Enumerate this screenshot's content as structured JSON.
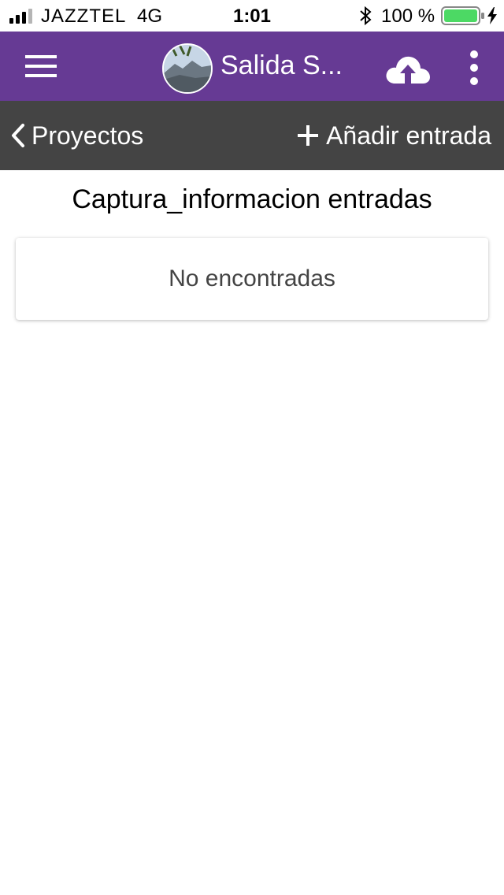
{
  "status_bar": {
    "carrier": "JAZZTEL",
    "network": "4G",
    "time": "1:01",
    "battery": "100 %",
    "battery_color": "#4cd964"
  },
  "app_bar": {
    "title": "Salida S...",
    "background": "#663a94",
    "icons": [
      "menu-icon",
      "project-avatar",
      "cloud-upload-icon",
      "more-vertical-icon"
    ]
  },
  "nav_bar": {
    "back_label": "Proyectos",
    "add_label": "Añadir entrada",
    "background": "#444444"
  },
  "main": {
    "title": "Captura_informacion entradas",
    "empty_message": "No encontradas"
  }
}
